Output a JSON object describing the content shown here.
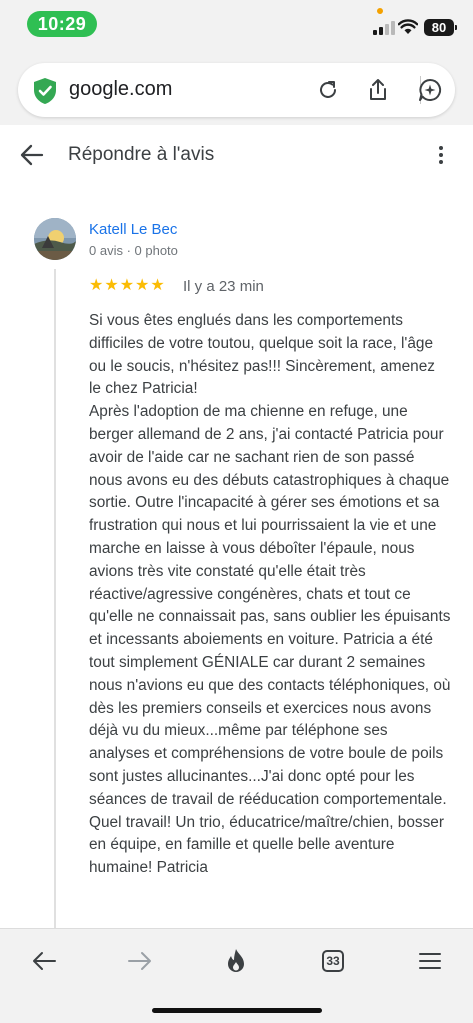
{
  "status_bar": {
    "time": "10:29",
    "battery": "80",
    "accent_color": "#2fbf53"
  },
  "browser": {
    "url": "google.com",
    "icons": [
      "shield-check-icon",
      "reload-icon",
      "share-icon",
      "assistant-icon"
    ]
  },
  "page": {
    "title": "Répondre à l'avis"
  },
  "review": {
    "author": "Katell Le Bec",
    "meta": "0 avis · 0 photo",
    "stars": "★★★★★",
    "rating": 5,
    "time_ago": "Il y a 23 min",
    "text": "Si vous êtes englués dans les comportements difficiles de votre toutou, quelque soit la race, l'âge ou le soucis, n'hésitez pas!!! Sincèrement, amenez le chez Patricia!\nAprès l'adoption de ma chienne en refuge, une berger allemand de 2 ans, j'ai contacté Patricia pour avoir de l'aide car ne sachant rien de son passé nous avons eu des débuts catastrophiques à chaque sortie. Outre l'incapacité à gérer ses émotions et sa frustration qui nous et lui pourrissaient la vie et une marche en laisse à vous déboîter l'épaule, nous avions très vite constaté qu'elle était très réactive/agressive congénères, chats et tout ce qu'elle ne connaissait pas, sans oublier les épuisants et incessants aboiements en voiture. Patricia a été tout simplement GÉNIALE car durant 2 semaines nous n'avions eu que des contacts téléphoniques, où dès les premiers conseils et exercices nous avons déjà vu du mieux...même par téléphone ses analyses et compréhensions de votre boule de poils sont justes allucinantes...J'ai donc opté pour les séances de travail de rééducation comportementale. Quel travail! Un trio, éducatrice/maître/chien, bosser en équipe, en famille et quelle belle aventure humaine! Patricia"
  },
  "toolbar": {
    "tabs_count": "33",
    "icons": [
      "back-icon",
      "forward-icon",
      "flame-icon",
      "tabs-icon",
      "menu-icon"
    ]
  }
}
